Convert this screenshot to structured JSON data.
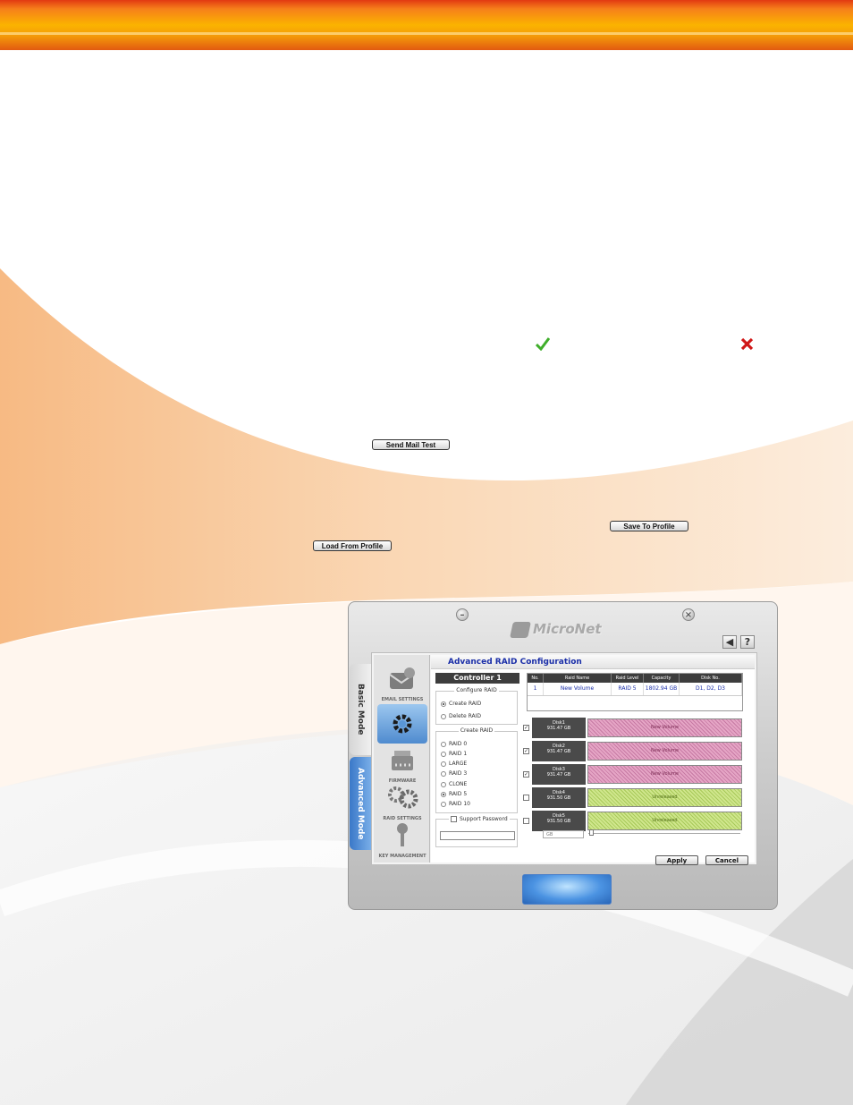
{
  "doc": {
    "send_mail_test_label": "Send Mail Test",
    "save_to_profile_label": "Save To Profile",
    "load_from_profile_label": "Load From Profile"
  },
  "icons": {
    "success": "check-icon",
    "failure": "x-icon",
    "colors": {
      "check": "#3fae2a",
      "x": "#d01818",
      "accent_bar": "#fbb300"
    }
  },
  "app": {
    "brand": "MicroNet",
    "tabs": {
      "basic": "Basic Mode",
      "advanced": "Advanced Mode"
    },
    "nav": [
      {
        "label": "EMAIL SETTINGS",
        "icon": "email-settings-icon"
      },
      {
        "label": "",
        "icon": "gear-icon"
      },
      {
        "label": "FIRMWARE",
        "icon": "firmware-icon"
      },
      {
        "label": "RAID SETTINGS",
        "icon": "raid-settings-icon"
      },
      {
        "label": "KEY MANAGEMENT",
        "icon": "key-management-icon"
      }
    ],
    "title": "Advanced RAID Configuration",
    "controller": "Controller 1",
    "configure_group": "Configure RAID",
    "configure_options": [
      {
        "label": "Create RAID",
        "selected": true
      },
      {
        "label": "Delete RAID",
        "selected": false
      }
    ],
    "create_group": "Create RAID",
    "create_options": [
      {
        "label": "RAID 0",
        "selected": false
      },
      {
        "label": "RAID 1",
        "selected": false
      },
      {
        "label": "LARGE",
        "selected": false
      },
      {
        "label": "RAID 3",
        "selected": false
      },
      {
        "label": "CLONE",
        "selected": false
      },
      {
        "label": "RAID 5",
        "selected": true
      },
      {
        "label": "RAID 10",
        "selected": false
      }
    ],
    "support_password": "Support Password",
    "table": {
      "headers": [
        "No.",
        "Raid Name",
        "Raid Level",
        "Capacity",
        "Disk No."
      ],
      "rows": [
        [
          "1",
          "New Volume",
          "RAID 5",
          "1802.94 GB",
          "D1, D2, D3"
        ]
      ]
    },
    "disks": [
      {
        "name": "Disk1",
        "size": "931.47 GB",
        "checked": true,
        "status": "New Volume",
        "used": true
      },
      {
        "name": "Disk2",
        "size": "931.47 GB",
        "checked": true,
        "status": "New Volume",
        "used": true
      },
      {
        "name": "Disk3",
        "size": "931.47 GB",
        "checked": true,
        "status": "New Volume",
        "used": true
      },
      {
        "name": "Disk4",
        "size": "931.50 GB",
        "checked": false,
        "status": "Unreleased",
        "used": false
      },
      {
        "name": "Disk5",
        "size": "931.50 GB",
        "checked": false,
        "status": "Unreleased",
        "used": false
      }
    ],
    "unit": "GB",
    "apply_label": "Apply",
    "cancel_label": "Cancel"
  }
}
